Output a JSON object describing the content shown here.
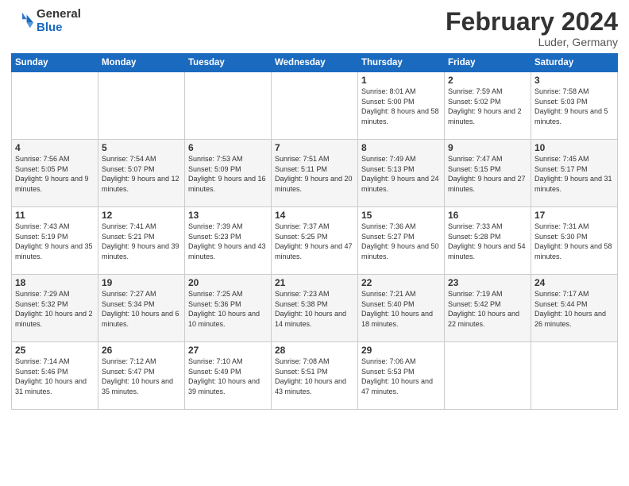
{
  "logo": {
    "general": "General",
    "blue": "Blue"
  },
  "title": "February 2024",
  "location": "Luder, Germany",
  "days_header": [
    "Sunday",
    "Monday",
    "Tuesday",
    "Wednesday",
    "Thursday",
    "Friday",
    "Saturday"
  ],
  "weeks": [
    [
      {
        "day": "",
        "info": ""
      },
      {
        "day": "",
        "info": ""
      },
      {
        "day": "",
        "info": ""
      },
      {
        "day": "",
        "info": ""
      },
      {
        "day": "1",
        "info": "Sunrise: 8:01 AM\nSunset: 5:00 PM\nDaylight: 8 hours\nand 58 minutes."
      },
      {
        "day": "2",
        "info": "Sunrise: 7:59 AM\nSunset: 5:02 PM\nDaylight: 9 hours\nand 2 minutes."
      },
      {
        "day": "3",
        "info": "Sunrise: 7:58 AM\nSunset: 5:03 PM\nDaylight: 9 hours\nand 5 minutes."
      }
    ],
    [
      {
        "day": "4",
        "info": "Sunrise: 7:56 AM\nSunset: 5:05 PM\nDaylight: 9 hours\nand 9 minutes."
      },
      {
        "day": "5",
        "info": "Sunrise: 7:54 AM\nSunset: 5:07 PM\nDaylight: 9 hours\nand 12 minutes."
      },
      {
        "day": "6",
        "info": "Sunrise: 7:53 AM\nSunset: 5:09 PM\nDaylight: 9 hours\nand 16 minutes."
      },
      {
        "day": "7",
        "info": "Sunrise: 7:51 AM\nSunset: 5:11 PM\nDaylight: 9 hours\nand 20 minutes."
      },
      {
        "day": "8",
        "info": "Sunrise: 7:49 AM\nSunset: 5:13 PM\nDaylight: 9 hours\nand 24 minutes."
      },
      {
        "day": "9",
        "info": "Sunrise: 7:47 AM\nSunset: 5:15 PM\nDaylight: 9 hours\nand 27 minutes."
      },
      {
        "day": "10",
        "info": "Sunrise: 7:45 AM\nSunset: 5:17 PM\nDaylight: 9 hours\nand 31 minutes."
      }
    ],
    [
      {
        "day": "11",
        "info": "Sunrise: 7:43 AM\nSunset: 5:19 PM\nDaylight: 9 hours\nand 35 minutes."
      },
      {
        "day": "12",
        "info": "Sunrise: 7:41 AM\nSunset: 5:21 PM\nDaylight: 9 hours\nand 39 minutes."
      },
      {
        "day": "13",
        "info": "Sunrise: 7:39 AM\nSunset: 5:23 PM\nDaylight: 9 hours\nand 43 minutes."
      },
      {
        "day": "14",
        "info": "Sunrise: 7:37 AM\nSunset: 5:25 PM\nDaylight: 9 hours\nand 47 minutes."
      },
      {
        "day": "15",
        "info": "Sunrise: 7:36 AM\nSunset: 5:27 PM\nDaylight: 9 hours\nand 50 minutes."
      },
      {
        "day": "16",
        "info": "Sunrise: 7:33 AM\nSunset: 5:28 PM\nDaylight: 9 hours\nand 54 minutes."
      },
      {
        "day": "17",
        "info": "Sunrise: 7:31 AM\nSunset: 5:30 PM\nDaylight: 9 hours\nand 58 minutes."
      }
    ],
    [
      {
        "day": "18",
        "info": "Sunrise: 7:29 AM\nSunset: 5:32 PM\nDaylight: 10 hours\nand 2 minutes."
      },
      {
        "day": "19",
        "info": "Sunrise: 7:27 AM\nSunset: 5:34 PM\nDaylight: 10 hours\nand 6 minutes."
      },
      {
        "day": "20",
        "info": "Sunrise: 7:25 AM\nSunset: 5:36 PM\nDaylight: 10 hours\nand 10 minutes."
      },
      {
        "day": "21",
        "info": "Sunrise: 7:23 AM\nSunset: 5:38 PM\nDaylight: 10 hours\nand 14 minutes."
      },
      {
        "day": "22",
        "info": "Sunrise: 7:21 AM\nSunset: 5:40 PM\nDaylight: 10 hours\nand 18 minutes."
      },
      {
        "day": "23",
        "info": "Sunrise: 7:19 AM\nSunset: 5:42 PM\nDaylight: 10 hours\nand 22 minutes."
      },
      {
        "day": "24",
        "info": "Sunrise: 7:17 AM\nSunset: 5:44 PM\nDaylight: 10 hours\nand 26 minutes."
      }
    ],
    [
      {
        "day": "25",
        "info": "Sunrise: 7:14 AM\nSunset: 5:46 PM\nDaylight: 10 hours\nand 31 minutes."
      },
      {
        "day": "26",
        "info": "Sunrise: 7:12 AM\nSunset: 5:47 PM\nDaylight: 10 hours\nand 35 minutes."
      },
      {
        "day": "27",
        "info": "Sunrise: 7:10 AM\nSunset: 5:49 PM\nDaylight: 10 hours\nand 39 minutes."
      },
      {
        "day": "28",
        "info": "Sunrise: 7:08 AM\nSunset: 5:51 PM\nDaylight: 10 hours\nand 43 minutes."
      },
      {
        "day": "29",
        "info": "Sunrise: 7:06 AM\nSunset: 5:53 PM\nDaylight: 10 hours\nand 47 minutes."
      },
      {
        "day": "",
        "info": ""
      },
      {
        "day": "",
        "info": ""
      }
    ]
  ]
}
